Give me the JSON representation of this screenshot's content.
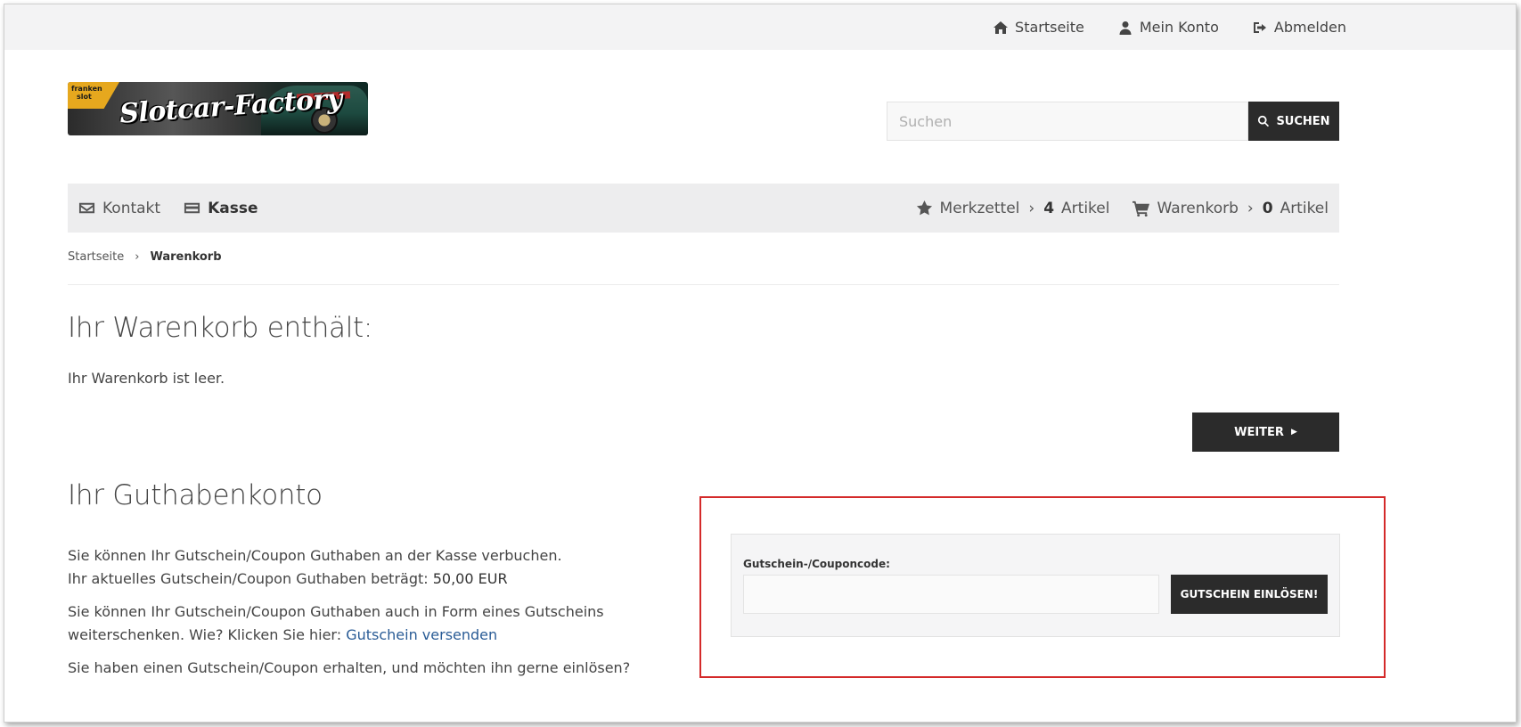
{
  "topnav": {
    "home": {
      "label": "Startseite",
      "icon": "home-icon"
    },
    "account": {
      "label": "Mein Konto",
      "icon": "user-icon"
    },
    "logout": {
      "label": "Abmelden",
      "icon": "sign-out-icon"
    }
  },
  "logo": {
    "text": "Slotcar-Factory",
    "tag_line1": "franken",
    "tag_line2": "slot"
  },
  "search": {
    "placeholder": "Suchen",
    "button_label": "SUCHEN"
  },
  "nav": {
    "contact": "Kontakt",
    "checkout": "Kasse",
    "wishlist": "Merkzettel",
    "wishlist_count": "4",
    "wishlist_unit": "Artikel",
    "cart": "Warenkorb",
    "cart_count": "0",
    "cart_unit": "Artikel"
  },
  "breadcrumb": {
    "home": "Startseite",
    "current": "Warenkorb"
  },
  "cart": {
    "heading": "Ihr Warenkorb enthält:",
    "empty_text": "Ihr Warenkorb ist leer.",
    "continue_label": "WEITER"
  },
  "credit": {
    "heading": "Ihr Guthabenkonto",
    "line1": "Sie können Ihr Gutschein/Coupon Guthaben an der Kasse verbuchen.",
    "line2_prefix": "Ihr aktuelles Gutschein/Coupon Guthaben beträgt: ",
    "line2_amount": "50,00 EUR",
    "line3": "Sie können Ihr Gutschein/Coupon Guthaben auch in Form eines Gutscheins",
    "line4_prefix": "weiterschenken. Wie? Klicken Sie hier: ",
    "line4_link": "Gutschein versenden",
    "line5": "Sie haben einen Gutschein/Coupon erhalten, und möchten ihn gerne einlösen?"
  },
  "coupon": {
    "label": "Gutschein-/Couponcode:",
    "value": "",
    "button_label": "GUTSCHEIN EINLÖSEN!"
  },
  "colors": {
    "dark_button": "#2b2b2b",
    "link": "#2a5c96",
    "highlight": "#d42a2a",
    "topbar": "#f3f3f4",
    "navbar": "#ededee"
  }
}
